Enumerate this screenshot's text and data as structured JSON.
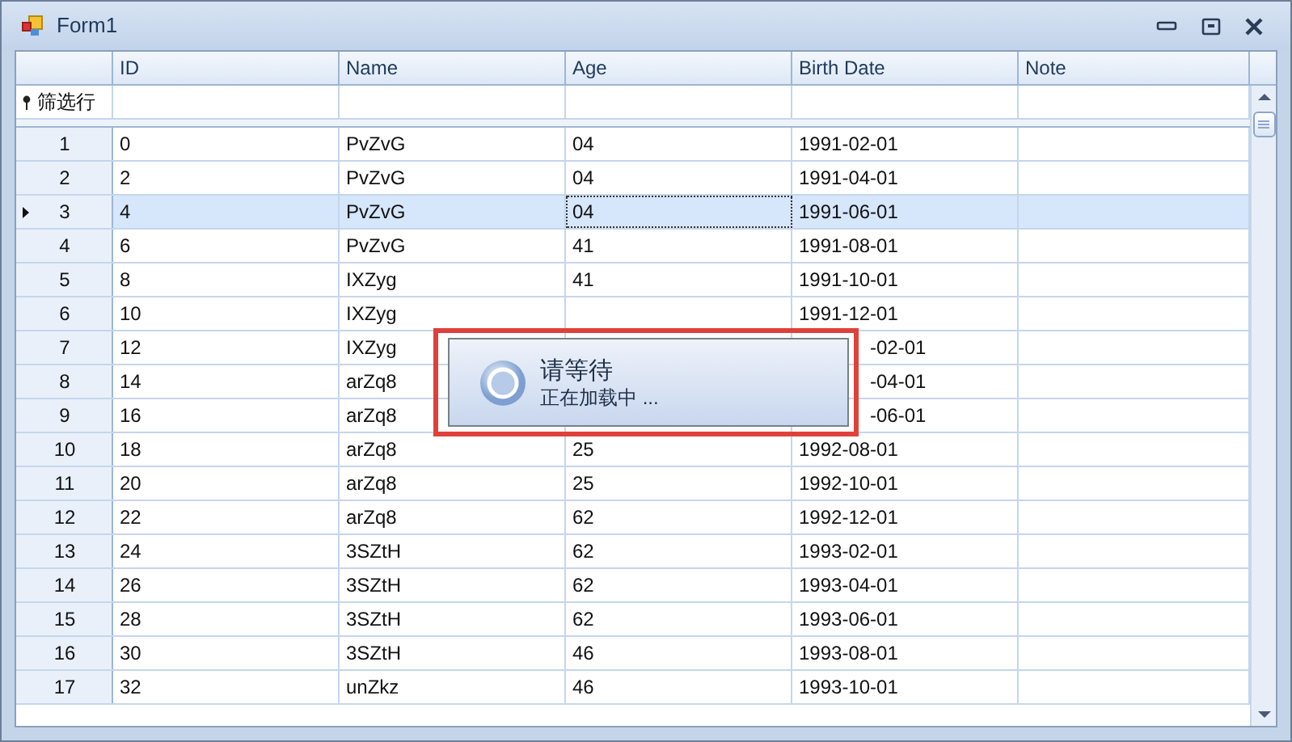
{
  "window": {
    "title": "Form1"
  },
  "grid": {
    "columns": [
      "ID",
      "Name",
      "Age",
      "Birth Date",
      "Note"
    ],
    "filter_row": {
      "label": "筛选行"
    },
    "rows": [
      {
        "header": "1",
        "id": "0",
        "name": "PvZvG",
        "age": "04",
        "birth_date": "1991-02-01",
        "selected": false
      },
      {
        "header": "2",
        "id": "2",
        "name": "PvZvG",
        "age": "04",
        "birth_date": "1991-04-01",
        "selected": false
      },
      {
        "header": "3",
        "id": "4",
        "name": "PvZvG",
        "age": "04",
        "birth_date": "1991-06-01",
        "selected": true
      },
      {
        "header": "4",
        "id": "6",
        "name": "PvZvG",
        "age": "41",
        "birth_date": "1991-08-01",
        "selected": false
      },
      {
        "header": "5",
        "id": "8",
        "name": "IXZyg",
        "age": "41",
        "birth_date": "1991-10-01",
        "selected": false
      },
      {
        "header": "6",
        "id": "10",
        "name": "IXZyg",
        "birth_date": "1991-12-01",
        "selected": false
      },
      {
        "header": "7",
        "id": "12",
        "name": "IXZyg",
        "birth_date": "-02-01",
        "selected": false
      },
      {
        "header": "8",
        "id": "14",
        "name": "arZq8",
        "birth_date": "-04-01",
        "selected": false
      },
      {
        "header": "9",
        "id": "16",
        "name": "arZq8",
        "birth_date": "-06-01",
        "selected": false
      },
      {
        "header": "10",
        "id": "18",
        "name": "arZq8",
        "age": "25",
        "birth_date": "1992-08-01",
        "selected": false
      },
      {
        "header": "11",
        "id": "20",
        "name": "arZq8",
        "age": "25",
        "birth_date": "1992-10-01",
        "selected": false
      },
      {
        "header": "12",
        "id": "22",
        "name": "arZq8",
        "age": "62",
        "birth_date": "1992-12-01",
        "selected": false
      },
      {
        "header": "13",
        "id": "24",
        "name": "3SZtH",
        "age": "62",
        "birth_date": "1993-02-01",
        "selected": false
      },
      {
        "header": "14",
        "id": "26",
        "name": "3SZtH",
        "age": "62",
        "birth_date": "1993-04-01",
        "selected": false
      },
      {
        "header": "15",
        "id": "28",
        "name": "3SZtH",
        "age": "62",
        "birth_date": "1993-06-01",
        "selected": false
      },
      {
        "header": "16",
        "id": "30",
        "name": "3SZtH",
        "age": "46",
        "birth_date": "1993-08-01",
        "selected": false
      },
      {
        "header": "17",
        "id": "32",
        "name": "unZkz",
        "age": "46",
        "birth_date": "1993-10-01",
        "selected": false
      }
    ]
  },
  "loading_dialog": {
    "title": "请等待",
    "message": "正在加载中 ..."
  }
}
